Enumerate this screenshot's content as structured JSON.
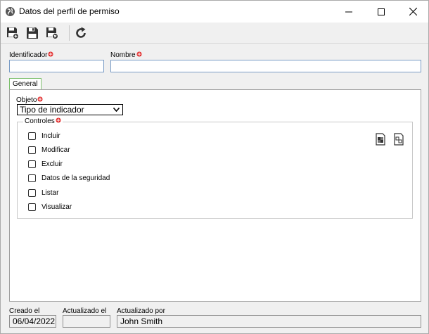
{
  "window": {
    "title": "Datos del perfil de permiso"
  },
  "toolbar": {
    "buttons": [
      {
        "icon": "save-new-icon"
      },
      {
        "icon": "save-icon"
      },
      {
        "icon": "save-close-icon"
      },
      {
        "icon": "refresh-icon"
      }
    ]
  },
  "form": {
    "identificador_label": "Identificador",
    "identificador_value": "",
    "nombre_label": "Nombre",
    "nombre_value": ""
  },
  "tabs": [
    {
      "label": "General",
      "selected": true
    }
  ],
  "general": {
    "objeto_label": "Objeto",
    "objeto_value": "Tipo de indicador",
    "controles_title": "Controles",
    "controles": [
      {
        "label": "Incluir",
        "checked": false
      },
      {
        "label": "Modificar",
        "checked": false
      },
      {
        "label": "Excluir",
        "checked": false
      },
      {
        "label": "Datos de la seguridad",
        "checked": false
      },
      {
        "label": "Listar",
        "checked": false
      },
      {
        "label": "Visualizar",
        "checked": false
      }
    ]
  },
  "footer": {
    "creado_label": "Creado el",
    "creado_value": "06/04/2022",
    "actualizado_label": "Actualizado el",
    "actualizado_value": "",
    "actualizado_por_label": "Actualizado por",
    "actualizado_por_value": "John Smith"
  },
  "colors": {
    "required": "#e02020",
    "input_border": "#7a9cc6",
    "tab_border": "#7cbf6c"
  }
}
